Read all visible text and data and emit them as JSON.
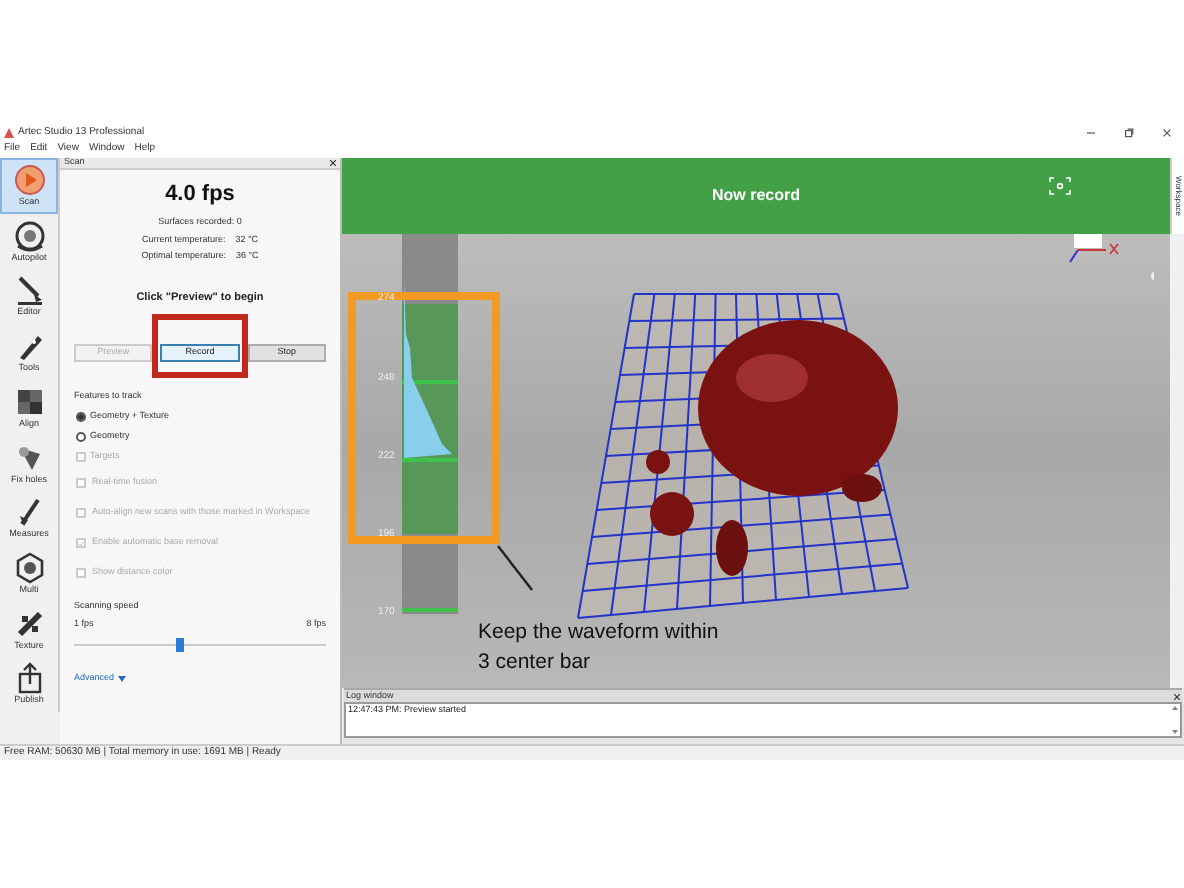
{
  "window": {
    "title": "Artec Studio 13 Professional"
  },
  "menu": [
    "File",
    "Edit",
    "View",
    "Window",
    "Help"
  ],
  "tools": [
    {
      "label": "Scan",
      "selected": true
    },
    {
      "label": "Autopilot",
      "selected": false
    },
    {
      "label": "Editor",
      "selected": false
    },
    {
      "label": "Tools",
      "selected": false
    },
    {
      "label": "Align",
      "selected": false
    },
    {
      "label": "Fix holes",
      "selected": false
    },
    {
      "label": "Measures",
      "selected": false
    },
    {
      "label": "Multi",
      "selected": false
    },
    {
      "label": "Texture",
      "selected": false
    },
    {
      "label": "Publish",
      "selected": false
    }
  ],
  "scan_panel": {
    "title": "Scan",
    "fps": "4.0 fps",
    "stats": [
      {
        "label": "Surfaces recorded: 0"
      },
      {
        "label": "Current temperature:",
        "value": "32 °C"
      },
      {
        "label": "Optimal temperature:",
        "value": "36 °C"
      }
    ],
    "hint": "Click \"Preview\" to begin",
    "buttons": [
      {
        "label": "Preview",
        "disabled": true,
        "highlighted": false
      },
      {
        "label": "Record",
        "disabled": false,
        "highlighted": true
      },
      {
        "label": "Stop",
        "disabled": false,
        "highlighted": false
      }
    ],
    "features_label": "Features to track",
    "features": [
      {
        "kind": "radio",
        "label": "Geometry + Texture",
        "selected": true,
        "disabled": false
      },
      {
        "kind": "radio",
        "label": "Geometry",
        "selected": false,
        "disabled": false
      },
      {
        "kind": "checkbox",
        "label": "Targets",
        "checked": false,
        "disabled": true
      }
    ],
    "options": [
      {
        "label": "Real-time fusion",
        "checked": false,
        "disabled": true
      },
      {
        "label": "Auto-align new scans with those marked in Workspace",
        "checked": false,
        "disabled": true
      },
      {
        "label": "Enable automatic base removal",
        "checked": true,
        "disabled": true
      },
      {
        "label": "Show distance color",
        "checked": false,
        "disabled": true
      }
    ],
    "speed": {
      "label": "Scanning speed",
      "min_label": "1 fps",
      "max_label": "8 fps",
      "level": 0.42
    },
    "advanced": "Advanced"
  },
  "viewport": {
    "banner": "Now record",
    "side_tab": "Workspace",
    "scale_labels": [
      "274",
      "248",
      "222",
      "196",
      "170"
    ],
    "note": "Keep the waveform within 3 center bar"
  },
  "log_window": {
    "title": "Log window",
    "entries": [
      "12:47:43 PM: Preview started"
    ]
  },
  "status_bar": "Free RAM: 50630 MB | Total memory in use: 1691 MB | Ready"
}
